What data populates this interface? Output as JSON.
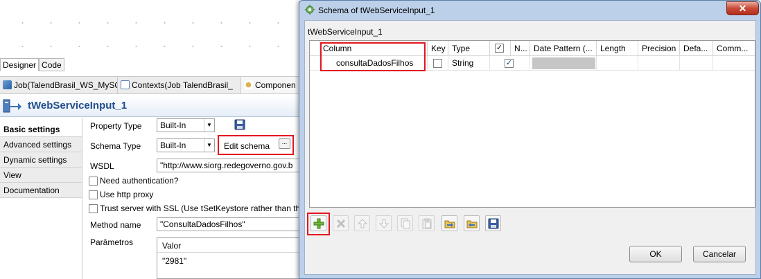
{
  "designer_tabs": [
    "Designer",
    "Code"
  ],
  "editor_tabs": [
    {
      "label": "Job(TalendBrasil_WS_MySQ",
      "icon": "job-icon"
    },
    {
      "label": "Contexts(Job TalendBrasil_",
      "icon": "contexts-icon"
    },
    {
      "label": "Componen",
      "icon": "component-icon"
    }
  ],
  "component": {
    "title": "tWebServiceInput_1",
    "icon": "web-service-icon"
  },
  "settings_nav": [
    "Basic settings",
    "Advanced settings",
    "Dynamic settings",
    "View",
    "Documentation"
  ],
  "form": {
    "property_type_label": "Property Type",
    "property_type_value": "Built-In",
    "schema_type_label": "Schema Type",
    "schema_type_value": "Built-In",
    "edit_schema_label": "Edit schema",
    "edit_schema_dots": "...",
    "wsdl_label": "WSDL",
    "wsdl_value": "\"http://www.siorg.redegoverno.gov.b",
    "need_auth_label": "Need authentication?",
    "use_proxy_label": "Use http proxy",
    "trust_ssl_label": "Trust server with SSL (Use tSetKeystore rather than this",
    "method_name_label": "Method name",
    "method_name_value": "\"ConsultaDadosFilhos\"",
    "parametros_label": "Parâmetros",
    "param_header": "Valor",
    "param_value": "\"2981\""
  },
  "dialog": {
    "title": "Schema of tWebServiceInput_1",
    "close_glyph": "✕",
    "component_name": "tWebServiceInput_1",
    "columns": [
      "Column",
      "Key",
      "Type",
      "",
      "N...",
      "Date Pattern (...",
      "Length",
      "Precision",
      "Defa...",
      "Comm..."
    ],
    "rows": [
      {
        "column": "consultaDadosFilhos",
        "key": false,
        "type": "String",
        "nullable": true,
        "date_pattern": "",
        "length": "",
        "precision": "",
        "default": "",
        "comment": ""
      }
    ],
    "toolbar": [
      {
        "name": "add-button",
        "icon": "plus-icon",
        "enabled": true
      },
      {
        "name": "remove-button",
        "icon": "remove-icon",
        "enabled": false
      },
      {
        "name": "move-up-button",
        "icon": "arrow-up-icon",
        "enabled": false
      },
      {
        "name": "move-down-button",
        "icon": "arrow-down-icon",
        "enabled": false
      },
      {
        "name": "copy-button",
        "icon": "copy-icon",
        "enabled": false
      },
      {
        "name": "paste-button",
        "icon": "paste-icon",
        "enabled": false
      },
      {
        "name": "import-button",
        "icon": "import-icon",
        "enabled": true
      },
      {
        "name": "export-button",
        "icon": "export-icon",
        "enabled": true
      },
      {
        "name": "save-button",
        "icon": "save-icon",
        "enabled": true
      }
    ],
    "ok_label": "OK",
    "cancel_label": "Cancelar"
  },
  "colors": {
    "highlight_red": "#e2151f",
    "title_blue": "#214d8b",
    "dialog_frame": "#bcd0ea"
  }
}
